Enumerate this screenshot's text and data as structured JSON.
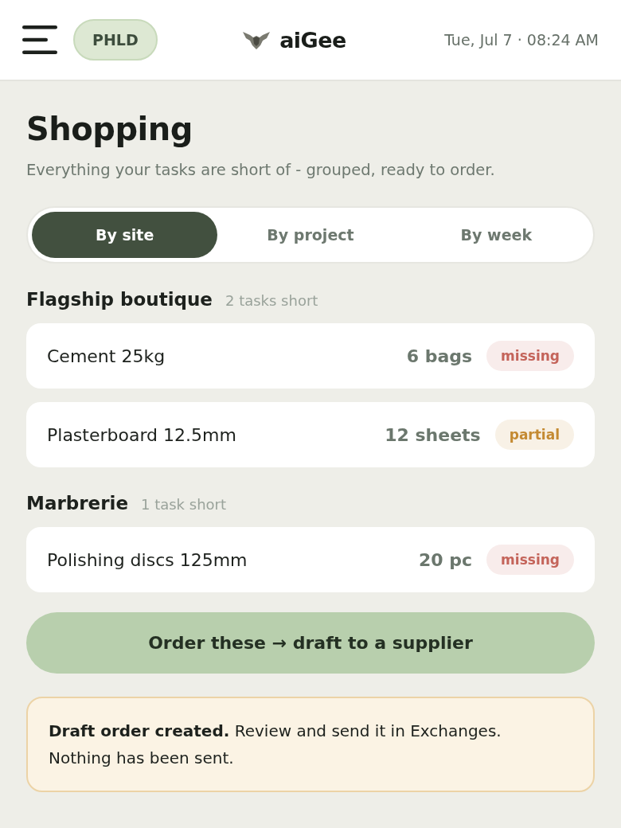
{
  "header": {
    "badge": "PHLD",
    "brand": "aiGee",
    "datetime": "Tue, Jul 7 · 08:24 AM"
  },
  "page": {
    "title": "Shopping",
    "subtitle": "Everything your tasks are short of - grouped, ready to order."
  },
  "tabs": [
    {
      "label": "By site",
      "selected": true
    },
    {
      "label": "By project",
      "selected": false
    },
    {
      "label": "By week",
      "selected": false
    }
  ],
  "groups": [
    {
      "name": "Flagship boutique",
      "count": "2 tasks short",
      "items": [
        {
          "name": "Cement 25kg",
          "quantity": "6 bags",
          "tag": {
            "label": "missing",
            "color": "#c4645a"
          }
        },
        {
          "name": "Plasterboard 12.5mm",
          "quantity": "12 sheets",
          "tag": {
            "label": "partial",
            "color": "#c48a32"
          }
        }
      ]
    },
    {
      "name": "Marbrerie",
      "count": "1 task short",
      "items": [
        {
          "name": "Polishing discs 125mm",
          "quantity": "20 pc",
          "tag": {
            "label": "missing",
            "color": "#c4645a"
          }
        }
      ]
    }
  ],
  "action": {
    "label": "Order these → draft to a supplier"
  },
  "notice": {
    "text": "**Draft order created.** Review and send it in Exchanges. Nothing has been sent."
  }
}
